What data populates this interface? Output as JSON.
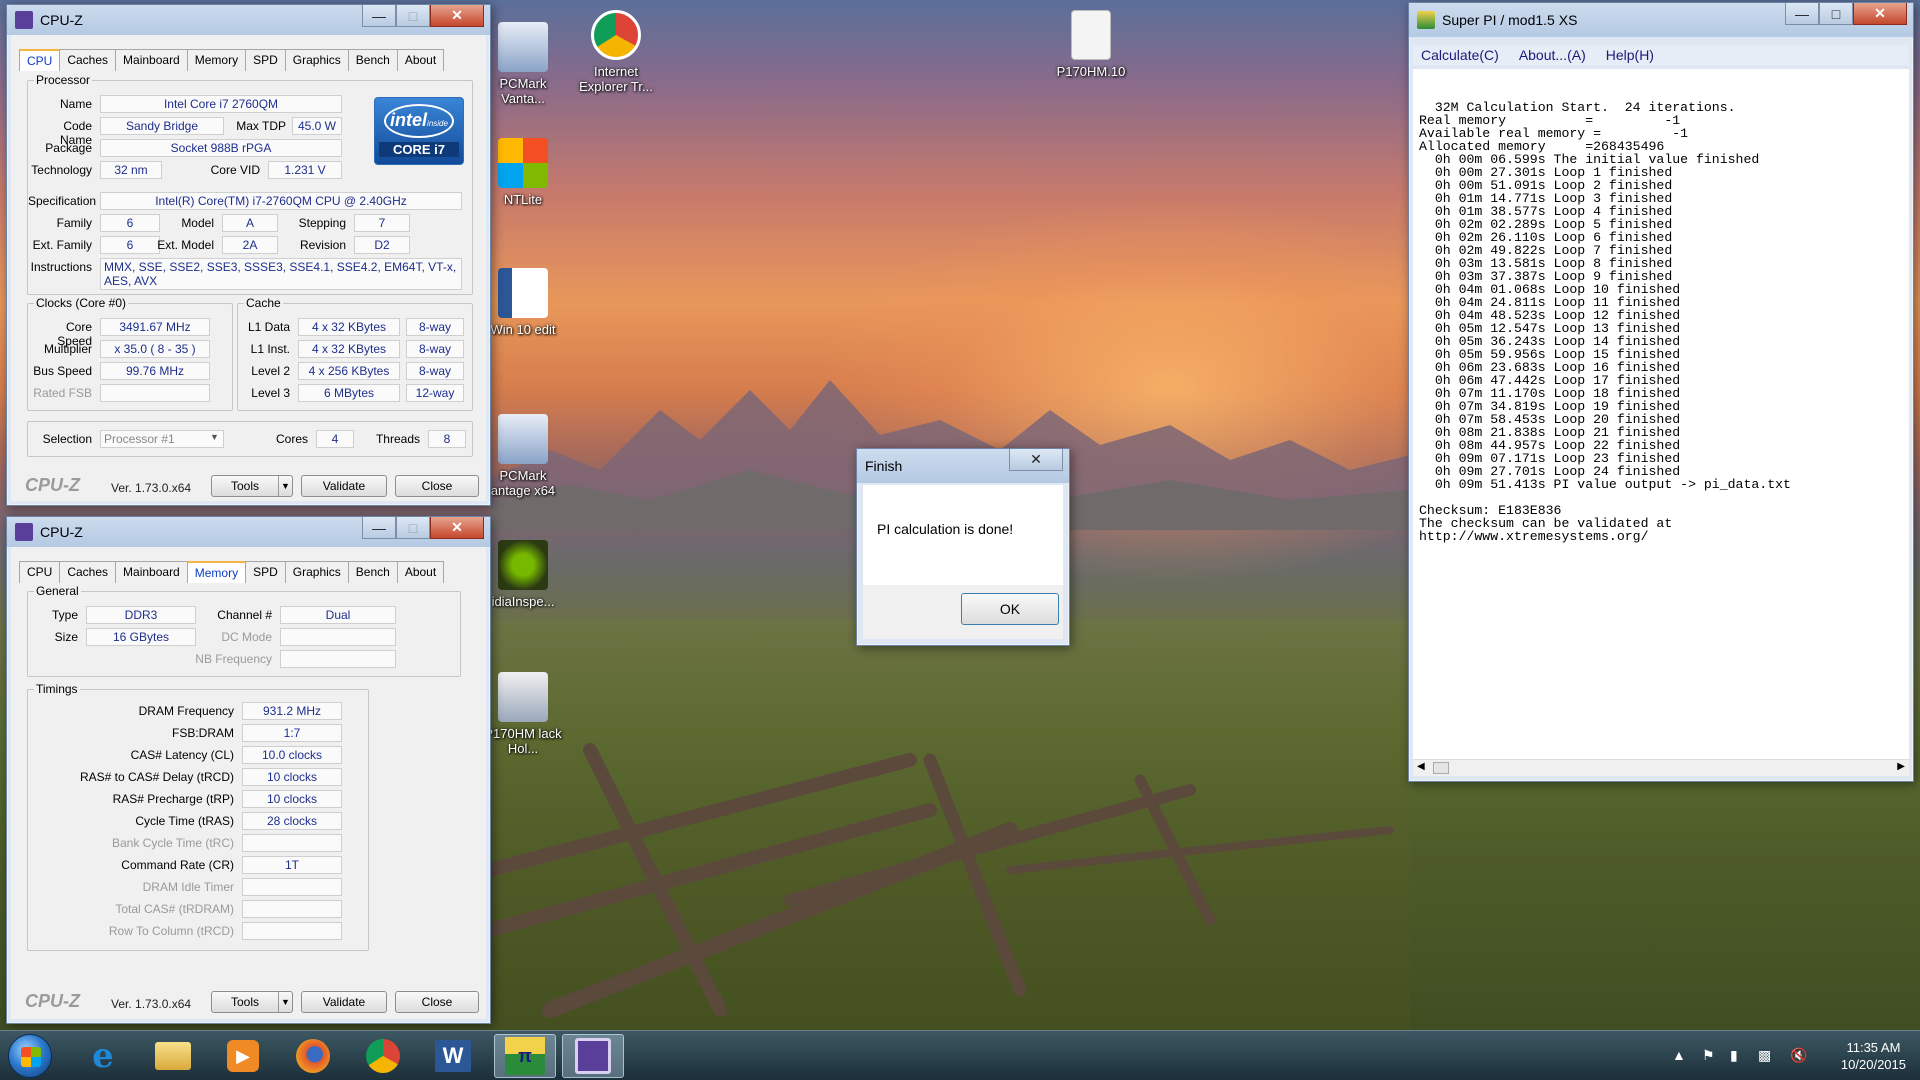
{
  "desktop": {
    "icons": [
      {
        "label": "PCMark Vanta...",
        "color": "#4a6aa8"
      },
      {
        "label": "Internet Explorer Tr...",
        "color": "#cf3d2e"
      },
      {
        "label": "P170HM.10",
        "color": "#f2f2f2"
      },
      {
        "label": "NTLite",
        "color": "#e27a2a"
      },
      {
        "label": "Win 10 edit",
        "color": "#2b5797"
      },
      {
        "label": "PCMark antage x64",
        "color": "#4a6aa8"
      },
      {
        "label": "idiaInspe...",
        "color": "#76b900"
      },
      {
        "label": "P170HM lack Hol...",
        "color": "#dcdcdc"
      }
    ]
  },
  "cpuz1": {
    "title": "CPU-Z",
    "tabs": [
      "CPU",
      "Caches",
      "Mainboard",
      "Memory",
      "SPD",
      "Graphics",
      "Bench",
      "About"
    ],
    "active_tab": "CPU",
    "processor": {
      "group_title": "Processor",
      "name_label": "Name",
      "name": "Intel Core i7 2760QM",
      "codename_label": "Code Name",
      "codename": "Sandy Bridge",
      "maxtdp_label": "Max TDP",
      "maxtdp": "45.0 W",
      "package_label": "Package",
      "package": "Socket 988B rPGA",
      "technology_label": "Technology",
      "technology": "32 nm",
      "corevid_label": "Core VID",
      "corevid": "1.231 V",
      "spec_label": "Specification",
      "spec": "Intel(R) Core(TM) i7-2760QM CPU @ 2.40GHz",
      "family_label": "Family",
      "family": "6",
      "model_label": "Model",
      "model": "A",
      "stepping_label": "Stepping",
      "stepping": "7",
      "extfamily_label": "Ext. Family",
      "extfamily": "6",
      "extmodel_label": "Ext. Model",
      "extmodel": "2A",
      "revision_label": "Revision",
      "revision": "D2",
      "instructions_label": "Instructions",
      "instructions": "MMX, SSE, SSE2, SSE3, SSSE3, SSE4.1, SSE4.2, EM64T, VT-x, AES, AVX"
    },
    "logo": {
      "intel": "intel",
      "inside": "inside",
      "core": "CORE i7"
    },
    "clocks": {
      "group_title": "Clocks (Core #0)",
      "corespeed_label": "Core Speed",
      "corespeed": "3491.67 MHz",
      "multiplier_label": "Multiplier",
      "multiplier": "x 35.0 ( 8 - 35 )",
      "busspeed_label": "Bus Speed",
      "busspeed": "99.76 MHz",
      "ratedfsb_label": "Rated FSB",
      "ratedfsb": ""
    },
    "cache": {
      "group_title": "Cache",
      "rows": [
        {
          "label": "L1 Data",
          "size": "4 x 32 KBytes",
          "way": "8-way"
        },
        {
          "label": "L1 Inst.",
          "size": "4 x 32 KBytes",
          "way": "8-way"
        },
        {
          "label": "Level 2",
          "size": "4 x 256 KBytes",
          "way": "8-way"
        },
        {
          "label": "Level 3",
          "size": "6 MBytes",
          "way": "12-way"
        }
      ]
    },
    "selection_label": "Selection",
    "selection": "Processor #1",
    "cores_label": "Cores",
    "cores": "4",
    "threads_label": "Threads",
    "threads": "8",
    "footer": {
      "brand": "CPU-Z",
      "version": "Ver. 1.73.0.x64",
      "tools": "Tools",
      "validate": "Validate",
      "close": "Close"
    }
  },
  "cpuz2": {
    "title": "CPU-Z",
    "tabs": [
      "CPU",
      "Caches",
      "Mainboard",
      "Memory",
      "SPD",
      "Graphics",
      "Bench",
      "About"
    ],
    "active_tab": "Memory",
    "general": {
      "group_title": "General",
      "type_label": "Type",
      "type": "DDR3",
      "size_label": "Size",
      "size": "16 GBytes",
      "channel_label": "Channel #",
      "channel": "Dual",
      "dcmode_label": "DC Mode",
      "dcmode": "",
      "nbfreq_label": "NB Frequency",
      "nbfreq": ""
    },
    "timings": {
      "group_title": "Timings",
      "rows": [
        {
          "label": "DRAM Frequency",
          "value": "931.2 MHz",
          "dim": false
        },
        {
          "label": "FSB:DRAM",
          "value": "1:7",
          "dim": false
        },
        {
          "label": "CAS# Latency (CL)",
          "value": "10.0 clocks",
          "dim": false
        },
        {
          "label": "RAS# to CAS# Delay (tRCD)",
          "value": "10 clocks",
          "dim": false
        },
        {
          "label": "RAS# Precharge (tRP)",
          "value": "10 clocks",
          "dim": false
        },
        {
          "label": "Cycle Time (tRAS)",
          "value": "28 clocks",
          "dim": false
        },
        {
          "label": "Bank Cycle Time (tRC)",
          "value": "",
          "dim": true
        },
        {
          "label": "Command Rate (CR)",
          "value": "1T",
          "dim": false
        },
        {
          "label": "DRAM Idle Timer",
          "value": "",
          "dim": true
        },
        {
          "label": "Total CAS# (tRDRAM)",
          "value": "",
          "dim": true
        },
        {
          "label": "Row To Column (tRCD)",
          "value": "",
          "dim": true
        }
      ]
    },
    "footer": {
      "brand": "CPU-Z",
      "version": "Ver. 1.73.0.x64",
      "tools": "Tools",
      "validate": "Validate",
      "close": "Close"
    }
  },
  "superpi": {
    "title": "Super PI / mod1.5 XS",
    "menu": [
      "Calculate(C)",
      "About...(A)",
      "Help(H)"
    ],
    "output": [
      "  32M Calculation Start.  24 iterations.",
      "Real memory          =         -1",
      "Available real memory =         -1",
      "Allocated memory     =268435496",
      "  0h 00m 06.599s The initial value finished",
      "  0h 00m 27.301s Loop 1 finished",
      "  0h 00m 51.091s Loop 2 finished",
      "  0h 01m 14.771s Loop 3 finished",
      "  0h 01m 38.577s Loop 4 finished",
      "  0h 02m 02.289s Loop 5 finished",
      "  0h 02m 26.110s Loop 6 finished",
      "  0h 02m 49.822s Loop 7 finished",
      "  0h 03m 13.581s Loop 8 finished",
      "  0h 03m 37.387s Loop 9 finished",
      "  0h 04m 01.068s Loop 10 finished",
      "  0h 04m 24.811s Loop 11 finished",
      "  0h 04m 48.523s Loop 12 finished",
      "  0h 05m 12.547s Loop 13 finished",
      "  0h 05m 36.243s Loop 14 finished",
      "  0h 05m 59.956s Loop 15 finished",
      "  0h 06m 23.683s Loop 16 finished",
      "  0h 06m 47.442s Loop 17 finished",
      "  0h 07m 11.170s Loop 18 finished",
      "  0h 07m 34.819s Loop 19 finished",
      "  0h 07m 58.453s Loop 20 finished",
      "  0h 08m 21.838s Loop 21 finished",
      "  0h 08m 44.957s Loop 22 finished",
      "  0h 09m 07.171s Loop 23 finished",
      "  0h 09m 27.701s Loop 24 finished",
      "  0h 09m 51.413s PI value output -> pi_data.txt",
      "",
      "Checksum: E183E836",
      "The checksum can be validated at",
      "http://www.xtremesystems.org/"
    ]
  },
  "dialog": {
    "title": "Finish",
    "message": "PI calculation is done!",
    "ok": "OK"
  },
  "taskbar": {
    "apps": [
      {
        "icon": "ie-icon",
        "color": "#1e88d8"
      },
      {
        "icon": "explorer-icon",
        "color": "#e9c46a"
      },
      {
        "icon": "media-player-icon",
        "color": "#f08a24"
      },
      {
        "icon": "firefox-icon",
        "color": "#e2592a"
      },
      {
        "icon": "chrome-icon",
        "color": "#3fa34d"
      },
      {
        "icon": "word-icon",
        "color": "#2b5797"
      },
      {
        "icon": "superpi-icon",
        "color": "#2a8c3a"
      },
      {
        "icon": "cpuz-icon",
        "color": "#5a3f9a"
      }
    ],
    "time": "11:35 AM",
    "date": "10/20/2015"
  }
}
